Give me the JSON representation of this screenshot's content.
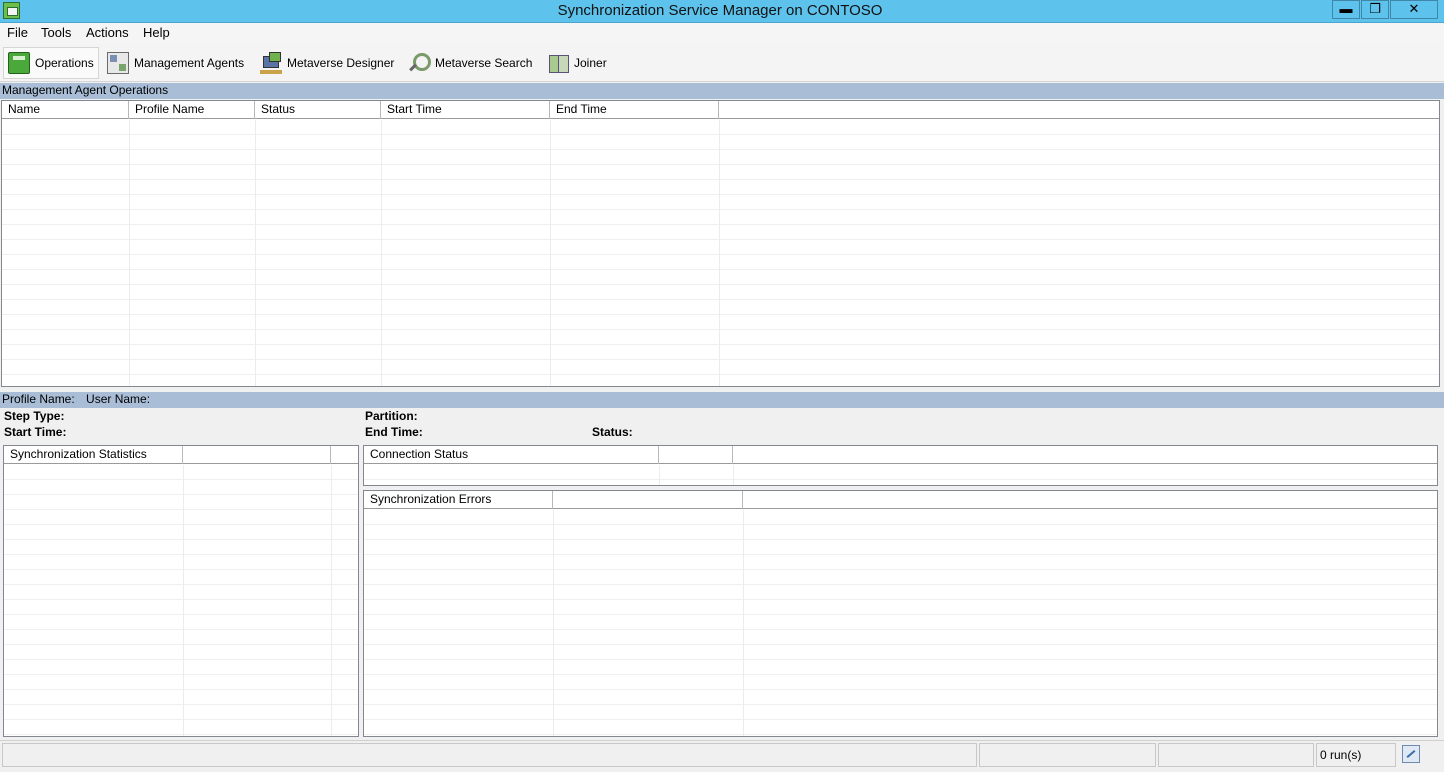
{
  "window": {
    "title": "Synchronization Service Manager on CONTOSO",
    "controls": {
      "minimize": "▬",
      "restore": "❐",
      "close": "✕"
    }
  },
  "menu": [
    "File",
    "Tools",
    "Actions",
    "Help"
  ],
  "toolbar": {
    "operations": "Operations",
    "management_agents": "Management Agents",
    "metaverse_designer": "Metaverse Designer",
    "metaverse_search": "Metaverse Search",
    "joiner": "Joiner"
  },
  "operations": {
    "section_title": "Management Agent Operations",
    "columns": [
      "Name",
      "Profile Name",
      "Status",
      "Start Time",
      "End Time"
    ],
    "rows": []
  },
  "details": {
    "profile_name_label": "Profile Name:",
    "user_name_label": "User Name:",
    "step_type_label": "Step Type:",
    "start_time_label": "Start Time:",
    "partition_label": "Partition:",
    "end_time_label": "End Time:",
    "status_label": "Status:"
  },
  "sync_statistics": {
    "header": "Synchronization Statistics"
  },
  "connection_status": {
    "header": "Connection Status"
  },
  "sync_errors": {
    "header": "Synchronization Errors"
  },
  "statusbar": {
    "runs": "0 run(s)"
  },
  "icons": {
    "app": "sync-service-app-icon",
    "operations": "operations-icon",
    "management_agents": "management-agents-icon",
    "metaverse_designer": "metaverse-designer-icon",
    "metaverse_search": "metaverse-search-icon",
    "joiner": "joiner-icon",
    "status": "network-status-icon"
  },
  "colors": {
    "titlebar": "#5ec3ec",
    "section_bar": "#a9bed6"
  }
}
